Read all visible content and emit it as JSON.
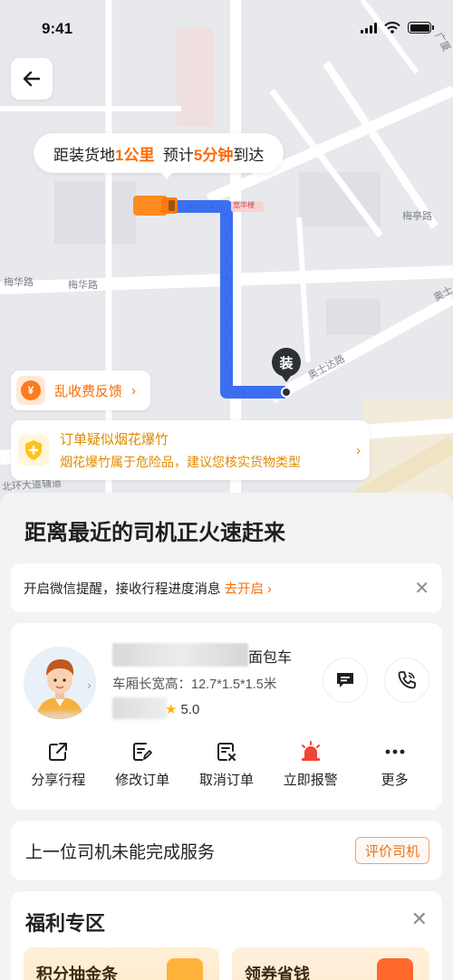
{
  "status_bar": {
    "time": "9:41"
  },
  "map": {
    "eta": {
      "prefix": "距装货地",
      "distance": "1公里",
      "mid": "预计",
      "minutes": "5分钟",
      "suffix": "到达"
    },
    "streets": {
      "meihua_left": "梅华路",
      "meihua_right": "梅华路",
      "meiting": "梅亭路",
      "aoshi": "奥士达路",
      "aoshi_short": "奥士",
      "beihuan": "北环大道辅道",
      "jinghua": "宽华楼",
      "guangkuan": "广厦"
    },
    "load_pin_label": "装",
    "fee_chip": {
      "icon": "¥",
      "label": "乱收费反馈"
    },
    "warning": {
      "title": "订单疑似烟花爆竹",
      "desc": "烟花爆竹属于危险品，建议您核实货物类型"
    }
  },
  "sheet": {
    "headline": "距离最近的司机正火速赶来",
    "notice": {
      "text": "开启微信提醒，接收行程进度消息",
      "action": "去开启"
    },
    "driver": {
      "vehicle_type": "面包车",
      "size": "车厢长宽高：12.7*1.5*1.5米",
      "rating": "5.0"
    },
    "actions": [
      {
        "label": "分享行程",
        "icon": "share-icon"
      },
      {
        "label": "修改订单",
        "icon": "edit-order-icon"
      },
      {
        "label": "取消订单",
        "icon": "cancel-order-icon"
      },
      {
        "label": "立即报警",
        "icon": "alarm-icon"
      },
      {
        "label": "更多",
        "icon": "more-icon"
      }
    ],
    "previous": {
      "text": "上一位司机未能完成服务",
      "button": "评价司机"
    },
    "welfare": {
      "title": "福利专区",
      "tiles": [
        {
          "label": "积分抽金条"
        },
        {
          "label": "领券省钱"
        }
      ]
    }
  },
  "colors": {
    "accent": "#ff6a00",
    "route": "#3b6ff0",
    "warning": "#e08a00"
  }
}
